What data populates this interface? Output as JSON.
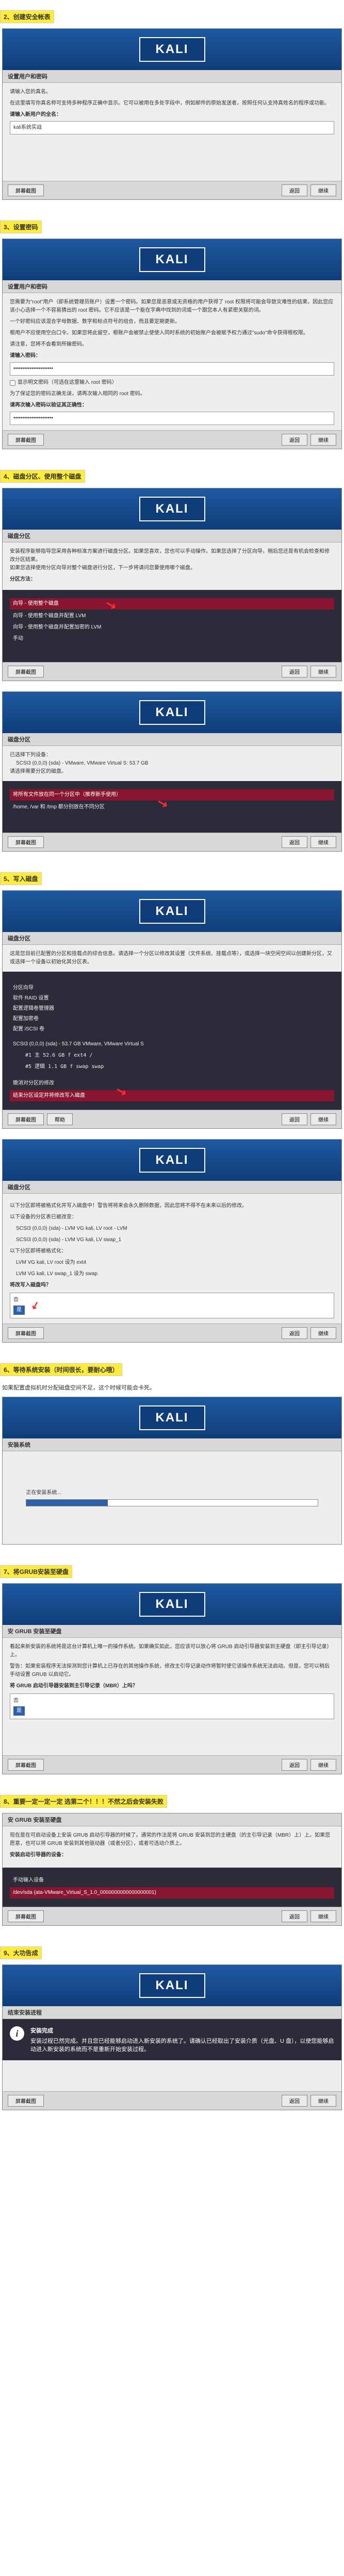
{
  "headings": {
    "h2": "2、创建安全帐表",
    "h3": "3、设置密码",
    "h4": "4、磁盘分区、使用整个磁盘",
    "h5": "5、写入磁盘",
    "h6": "6、等待系统安装（时间很长，要耐心哦）",
    "h6_sub": "如果配置虚拟机时分配磁盘空间不足，这个时候可能会卡死。",
    "h7": "7、将GRUB安装至硬盘",
    "h8": "8、重要一定一定一定 选第二个！！！不然之后会安装失败",
    "h9": "9、大功告成"
  },
  "logo": "KALI",
  "buttons": {
    "screenshot": "屏幕截图",
    "back": "返回",
    "continue": "继续"
  },
  "win2": {
    "title": "设置用户和密码",
    "intro": "请输入您的真名。",
    "desc": "在这里填写你真名称可支持多种程序正确中显示。它可以被用在多处字段中，例如邮件的原始发送者，按照任何认支持真姓名的程序或功能。",
    "label": "请输入新用户的全名：",
    "value": "kali系统实战"
  },
  "win3": {
    "title": "设置用户和密码",
    "p1": "您需要为\"root\"用户（即系统管理员账户）设置一个密码。如果您是恶意或无资格的用户获得了 root 权限将可能会导致灾难性的结果，因此您应该小心选择一个不容易猜出的 root 密码。它不应该是一个能在字典中找到的词或一个跟您本人有紧密关联的词。",
    "p2": "一个好密码应该混合字母数据、数字和标点符号的组合，而且要定期更新。",
    "p3": "根用户不应使用空白口令。如果您将此留空，根账户会被禁止使使入同时系统的初始账户会被赋予权力通过\"sudo\"命令获得根权限。",
    "p4": "请注意，您将不会看到所输密码。",
    "label1": "请输入密码：",
    "dots": "••••••••••••••••••••••",
    "checkbox": "显示明文密码（可选在这里输入 root 密码）",
    "p5": "为了保证您的密码正确无误，请再次输入相同的 root 密码。",
    "label2": "请再次输入密码以验证其正确性："
  },
  "win4a": {
    "title": "磁盘分区",
    "p1": "安装程序能够指导您采用各种标准方案进行磁盘分区。如果您喜欢，您也可以手动操作。如果您选择了分区向导，稍后您还是有机会检查和修改分区结果。",
    "p2": "如果您选择使用分区向导对整个磁盘进行分区，下一步将请问您要使用哪个磁盘。",
    "label": "分区方法：",
    "opt1": "向导 - 使用整个磁盘",
    "opt2": "向导 - 使用整个磁盘并配置 LVM",
    "opt3": "向导 - 使用整个磁盘并配置加密的 LVM",
    "opt4": "手动"
  },
  "win4b": {
    "title": "磁盘分区",
    "p1": "已选择下列设备：",
    "disk": "SCSI3 (0,0,0) (sda) - VMware, VMware Virtual S: 53.7 GB",
    "p2": "请选择需要分区的磁盘。",
    "opt1": "将所有文件放在同一个分区中（推荐新手使用）",
    "opt2": "/home, /var 和 /tmp 都分别放在不同分区"
  },
  "win5a": {
    "title": "磁盘分区",
    "p1": "这是您目前已配置的分区和挂载点的综合信息。请选择一个分区以修改其设置（文件系统、挂载点等），或选择一块空闲空间以创建新分区，又或选择一个设备以初始化其分区表。",
    "cfg1": "分区向导",
    "cfg2": "软件 RAID 设置",
    "cfg3": "配置逻辑卷管理器",
    "cfg4": "配置加密卷",
    "cfg5": "配置 iSCSI 卷",
    "disk": "SCSI3 (0,0,0) (sda) - 53.7 GB VMware, VMware Virtual S",
    "part1": "#1    主    52.6 GB    f    ext4    /",
    "part2": "#5    逻辑   1.1 GB    f    swap    swap",
    "undo": "撤消对分区的修改",
    "done": "结束分区设定并将修改写入磁盘"
  },
  "win5b": {
    "title": "磁盘分区",
    "p1": "以下分区即将被格式化并写入磁盘中！警告将将来会永久删除数据，因此您将不得不在未来以后的修改。",
    "p2": "以下设备的分区表已被改变：",
    "dev": "SCSI3 (0,0,0) (sda) - LVM VG kali, LV root - LVM",
    "dev2": "SCSI3 (0,0,0) (sda) - LVM VG kali, LV swap_1",
    "p3": "以下分区即将被格式化：",
    "f1": "LVM VG kali, LV root 设为 ext4",
    "f2": "LVM VG kali, LV swap_1 设为 swap",
    "q": "将改写入磁盘吗？",
    "no": "否",
    "yes": "是"
  },
  "win6": {
    "title": "安装系统",
    "msg": "正在安装系统..."
  },
  "win7": {
    "title": "安 GRUB 安装至硬盘",
    "p1": "看起来新安装的系统将是这台计算机上唯一的操作系统。如果确实如此，您应该可以放心将 GRUB 启动引导器安装到主硬盘（即主引导记录）上。",
    "p2": "警告：如果安装程序无法探测到您计算机上已存在的其他操作系统，修改主引导记录动作将暂时使它该操作系统无法启动。但是，您可以稍后手动设置 GRUB 以启动它。",
    "q": "将 GRUB 启动引导器安装到主引导记录（MBR）上吗？",
    "no": "否",
    "yes": "是"
  },
  "win8": {
    "title": "安 GRUB 安装至硬盘",
    "p1": "现在是在可启动设备上安装 GRUB 启动引导器的时候了。通常的作法是将 GRUB 安装到您的主硬盘（的主引导记录（MBR）上）上。如果您愿意，也可以将 GRUB 安装到其他驱动器（或者分区），或者可选动介质上。",
    "label": "安装启动引导器的设备：",
    "opt1": "手动输入设备",
    "opt2": "/dev/sda (ata-VMware_Virtual_S_1.0_0000000000000000001)"
  },
  "win9": {
    "title": "结束安装进程",
    "info_title": "安装完成",
    "info_text": "安装过程已然完成。并且您已经能够启动进入新安装的系统了。请确认已经取出了安装介质（光盘、U 盘），以使您能够启动进入新安装的系统而不是重新开始安装过程。"
  }
}
